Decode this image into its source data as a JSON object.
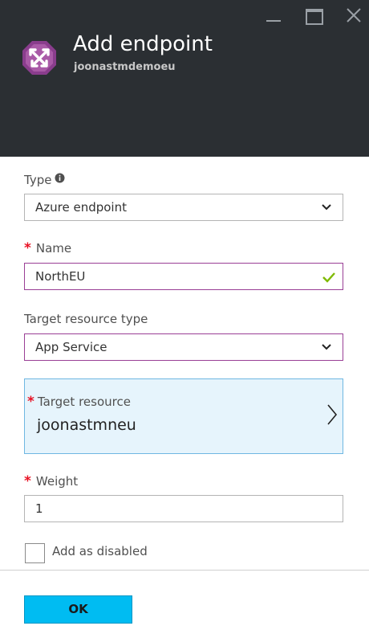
{
  "header": {
    "title": "Add endpoint",
    "subtitle": "joonastmdemoeu",
    "icon": "traffic-manager-icon",
    "background_color": "#2b2f33",
    "icon_color": "#8a3d8d"
  },
  "window_controls": {
    "minimize_icon": "minimize-icon",
    "maximize_icon": "maximize-icon",
    "close_icon": "close-icon"
  },
  "form": {
    "type": {
      "label": "Type",
      "value": "Azure endpoint",
      "info_icon": "info-icon"
    },
    "name": {
      "label": "Name",
      "required_marker": "*",
      "value": "NorthEU",
      "valid": true
    },
    "target_resource_type": {
      "label": "Target resource type",
      "value": "App Service"
    },
    "target_resource": {
      "label": "Target resource",
      "required_marker": "*",
      "value": "joonastmneu"
    },
    "weight": {
      "label": "Weight",
      "required_marker": "*",
      "value": "1"
    },
    "add_as_disabled": {
      "label": "Add as disabled",
      "checked": false
    }
  },
  "actions": {
    "ok_label": "OK"
  },
  "colors": {
    "accent_purple": "#9a3f96",
    "required_red": "#e81123",
    "valid_green": "#7fba00",
    "ok_button": "#00bcf2",
    "selected_blue_bg": "#e6f4fc"
  }
}
